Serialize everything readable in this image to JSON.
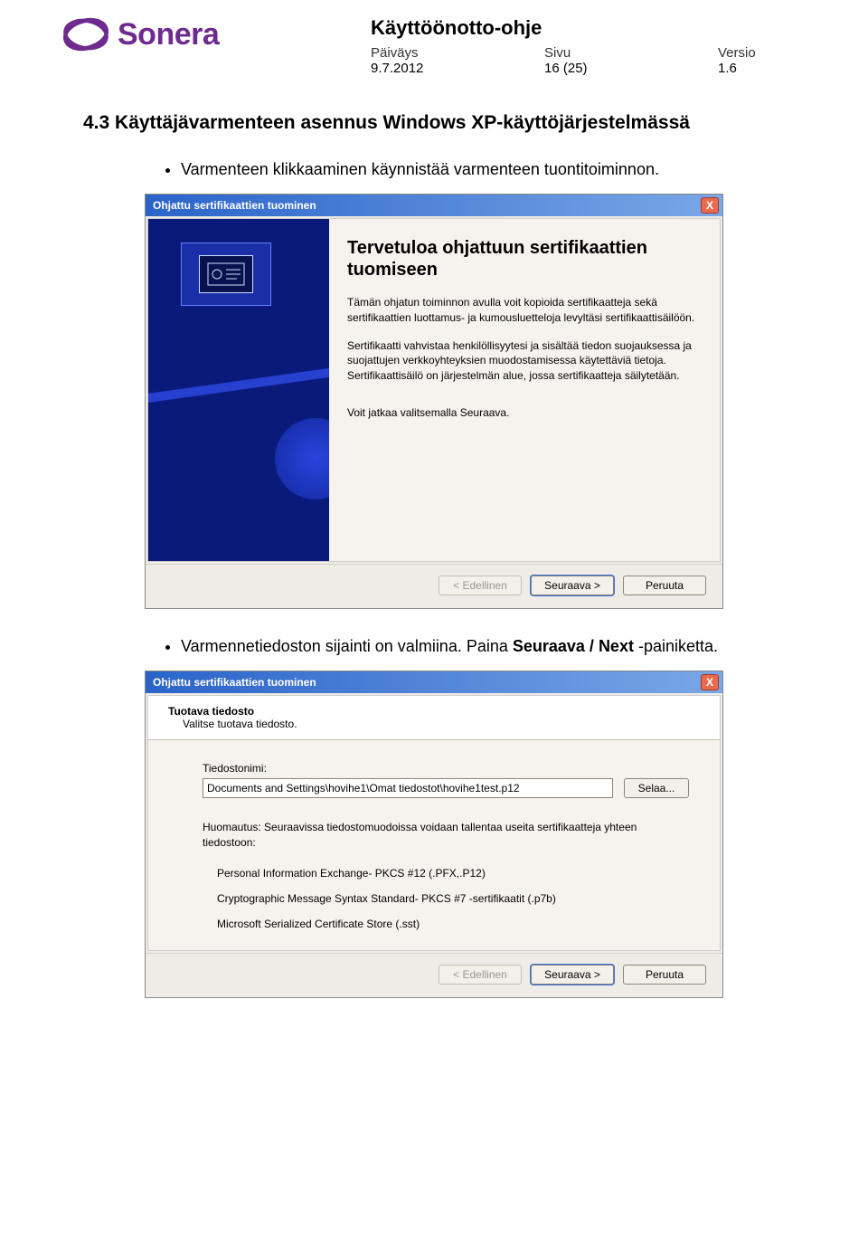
{
  "logo": {
    "brand": "Sonera"
  },
  "header": {
    "title": "Käyttöönotto-ohje",
    "date_label": "Päiväys",
    "date_value": "9.7.2012",
    "page_label": "Sivu",
    "page_value": "16 (25)",
    "version_label": "Versio",
    "version_value": "1.6"
  },
  "section": {
    "heading": "4.3 Käyttäjävarmenteen asennus Windows XP-käyttöjärjestelmässä",
    "bullet1": "Varmenteen klikkaaminen käynnistää varmenteen tuontitoiminnon.",
    "bullet2_pre": "Varmennetiedoston sijainti on valmiina. Paina ",
    "bullet2_bold": "Seuraava / Next",
    "bullet2_post": " -painiketta."
  },
  "wizard1": {
    "title": "Ohjattu sertifikaattien tuominen",
    "close": "X",
    "h1": "Tervetuloa ohjattuun sertifikaattien tuomiseen",
    "p1": "Tämän ohjatun toiminnon avulla voit kopioida sertifikaatteja sekä sertifikaattien luottamus- ja kumousluetteloja levyltäsi sertifikaattisäilöön.",
    "p2": "Sertifikaatti vahvistaa henkilöllisyytesi ja sisältää tiedon suojauksessa ja suojattujen verkkoyhteyksien muodostamisessa käytettäviä tietoja. Sertifikaattisäilö on järjestelmän alue, jossa sertifikaatteja säilytetään.",
    "p3": "Voit jatkaa valitsemalla Seuraava.",
    "btn_back": "< Edellinen",
    "btn_next": "Seuraava >",
    "btn_cancel": "Peruuta"
  },
  "wizard2": {
    "title": "Ohjattu sertifikaattien tuominen",
    "close": "X",
    "head_h1": "Tuotava tiedosto",
    "head_h2": "Valitse tuotava tiedosto.",
    "file_label": "Tiedostonimi:",
    "file_value": "Documents and Settings\\hovihe1\\Omat tiedostot\\hovihe1test.p12",
    "browse": "Selaa...",
    "note": "Huomautus: Seuraavissa tiedostomuodoissa voidaan tallentaa useita sertifikaatteja yhteen tiedostoon:",
    "item1": "Personal Information Exchange- PKCS #12 (.PFX,.P12)",
    "item2": "Cryptographic Message Syntax Standard- PKCS #7 -sertifikaatit (.p7b)",
    "item3": "Microsoft Serialized Certificate Store (.sst)",
    "btn_back": "< Edellinen",
    "btn_next": "Seuraava >",
    "btn_cancel": "Peruuta"
  }
}
